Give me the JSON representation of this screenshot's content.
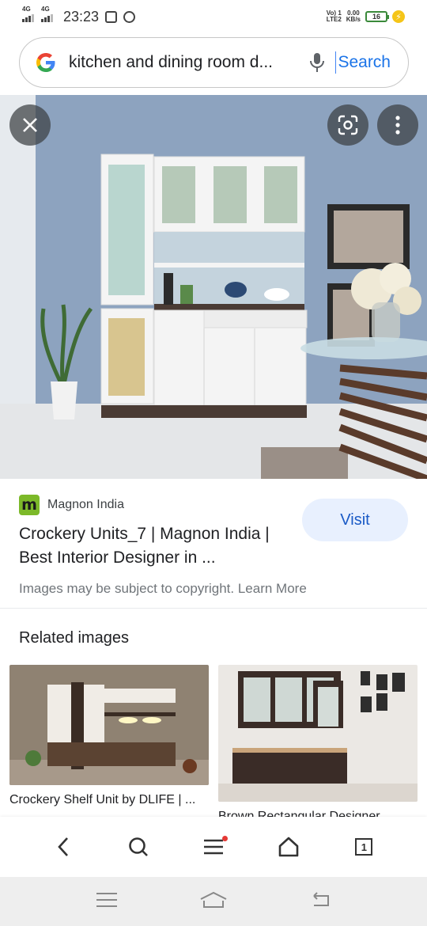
{
  "status_bar": {
    "network1": "4G",
    "network2": "4G",
    "time": "23:23",
    "volte_line1": "Vo) 1",
    "volte_line2": "LTE2",
    "speed_value": "0.00",
    "speed_unit": "KB/s",
    "battery": "16"
  },
  "search": {
    "query": "kitchen and dining room d...",
    "search_label": "Search"
  },
  "result": {
    "source": "Magnon India",
    "favicon_letter": "m",
    "title": "Crockery Units_7 | Magnon India | Best Interior Designer in ...",
    "visit_label": "Visit",
    "copyright": "Images may be subject to copyright. Learn More"
  },
  "related": {
    "heading": "Related images",
    "items": [
      {
        "caption": "Crockery Shelf Unit by DLIFE | ..."
      },
      {
        "caption": "Brown Rectangular Designer ..."
      }
    ]
  },
  "bottom_nav": {
    "tab_count": "1"
  },
  "colors": {
    "accent": "#1a73e8",
    "visit_bg": "#e8f0fe",
    "favicon": "#7cb929",
    "wall": "#8ea3bd"
  }
}
